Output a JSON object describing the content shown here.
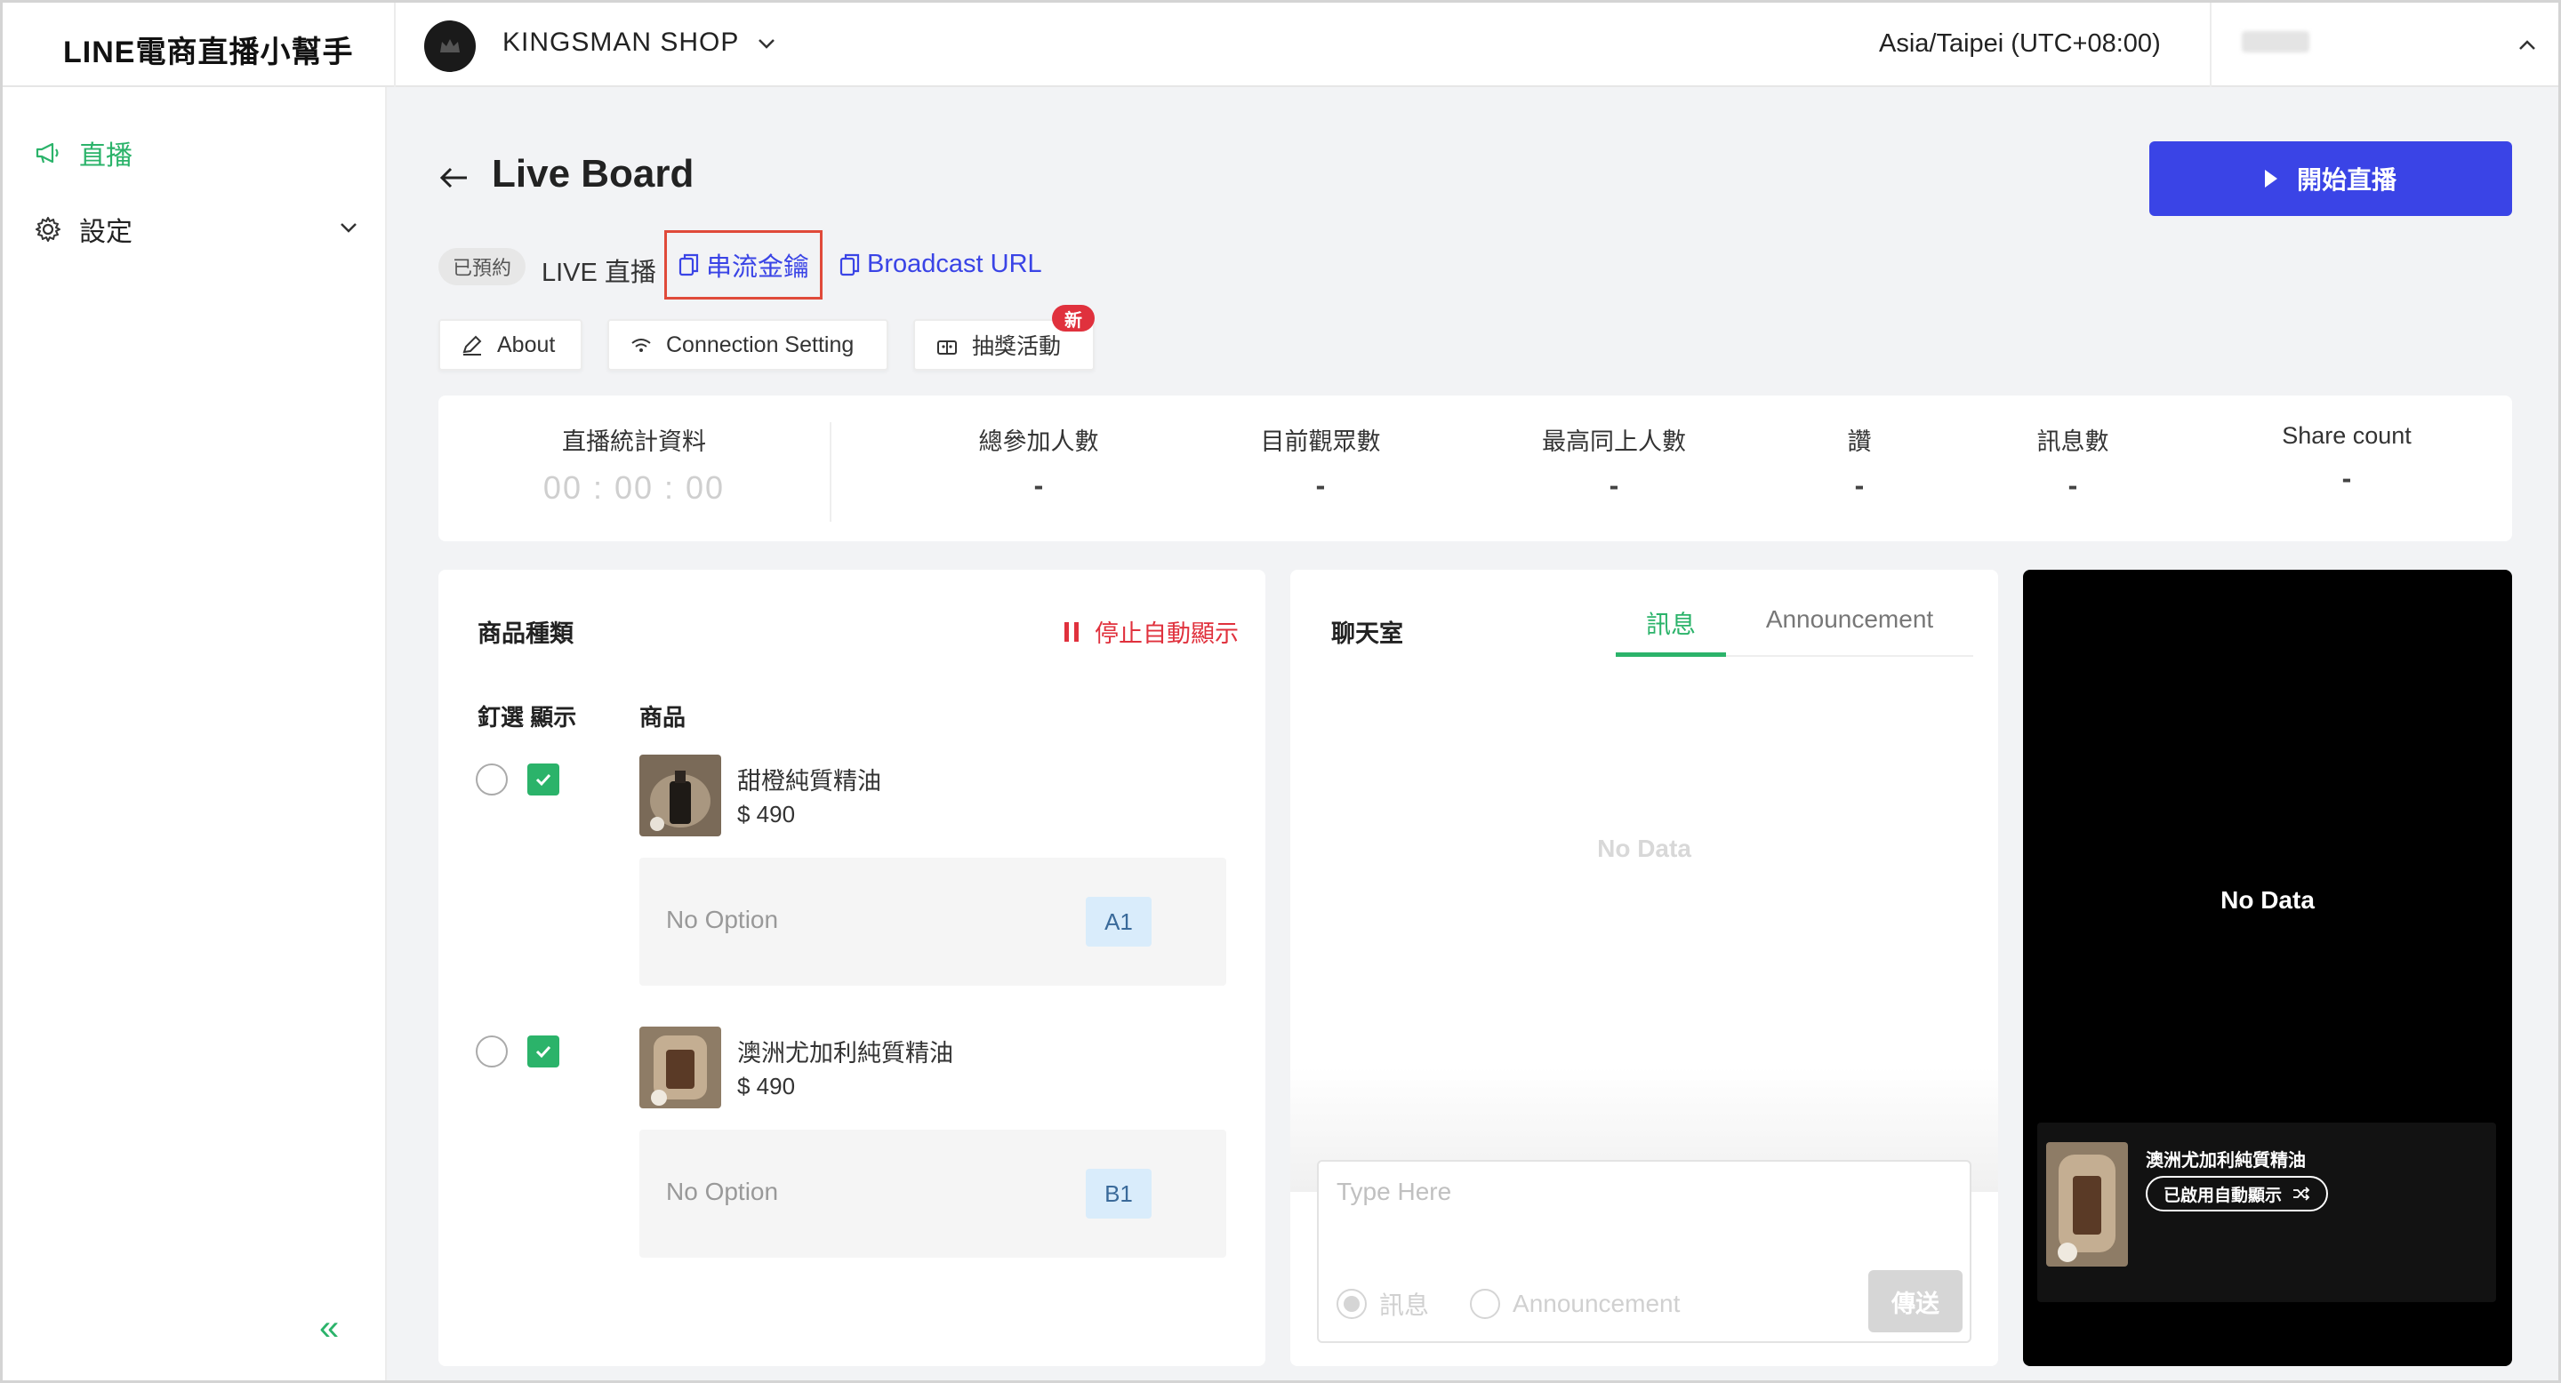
{
  "app": {
    "brand": "LINE電商直播小幫手"
  },
  "topbar": {
    "shop_name": "KINGSMAN SHOP",
    "timezone": "Asia/Taipei (UTC+08:00)"
  },
  "sidebar": {
    "items": [
      {
        "label": "直播"
      },
      {
        "label": "設定"
      }
    ],
    "collapse_glyph": "«"
  },
  "header": {
    "title": "Live Board",
    "start_button": "開始直播",
    "status_badge": "已預約",
    "live_label": "LIVE 直播",
    "stream_key_label": "串流金鑰",
    "broadcast_url_label": "Broadcast URL"
  },
  "tabs": {
    "about": "About",
    "connection": "Connection Setting",
    "lottery": "抽獎活動",
    "new_badge": "新"
  },
  "stats": {
    "timer_label": "直播統計資料",
    "timer_value": "00 : 00 : 00",
    "items": [
      {
        "label": "總參加人數",
        "value": "-"
      },
      {
        "label": "目前觀眾數",
        "value": "-"
      },
      {
        "label": "最高同上人數",
        "value": "-"
      },
      {
        "label": "讚",
        "value": "-"
      },
      {
        "label": "訊息數",
        "value": "-"
      },
      {
        "label": "Share count",
        "value": "-"
      }
    ]
  },
  "products": {
    "title": "商品種類",
    "stop_auto": "停止自動顯示",
    "col_pin_show": "釘選 顯示",
    "col_product": "商品",
    "items": [
      {
        "name": "甜橙純質精油",
        "price": "$ 490",
        "option": "No Option",
        "code": "A1",
        "pinned": false,
        "shown": true
      },
      {
        "name": "澳洲尤加利純質精油",
        "price": "$ 490",
        "option": "No Option",
        "code": "B1",
        "pinned": false,
        "shown": true
      }
    ]
  },
  "chat": {
    "title": "聊天室",
    "tab_message": "訊息",
    "tab_announcement": "Announcement",
    "no_data": "No Data",
    "placeholder": "Type Here",
    "radio_message": "訊息",
    "radio_announcement": "Announcement",
    "send": "傳送"
  },
  "preview": {
    "no_data": "No Data",
    "product_name": "澳洲尤加利純質精油",
    "auto_show_pill": "已啟用自動顯示"
  },
  "colors": {
    "accent_green": "#2bb36a",
    "primary_blue": "#3a44e6",
    "danger_red": "#e0313d"
  }
}
